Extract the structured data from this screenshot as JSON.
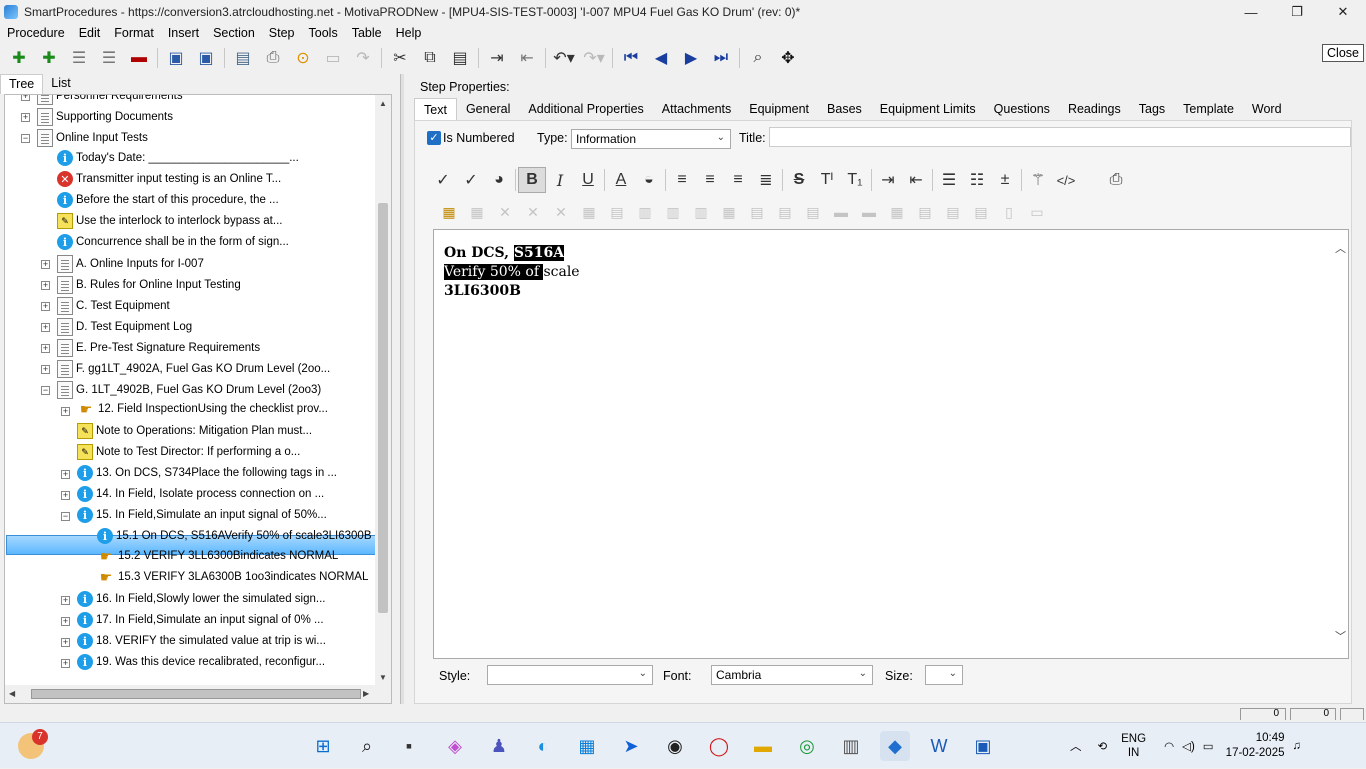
{
  "window": {
    "title": "SmartProcedures - https://conversion3.atrcloudhosting.net - MotivaPRODNew - [MPU4-SIS-TEST-0003] 'I-007 MPU4 Fuel Gas KO Drum' (rev: 0)*",
    "minimize": "—",
    "maximize": "❐",
    "close": "✕"
  },
  "menu": [
    "Procedure",
    "Edit",
    "Format",
    "Insert",
    "Section",
    "Step",
    "Tools",
    "Table",
    "Help"
  ],
  "close_tab": "Close",
  "tree_tabs": [
    "Tree",
    "List"
  ],
  "tree": [
    {
      "text": "Personnel Requirements",
      "icon": "doc",
      "level": 1,
      "expander": "+"
    },
    {
      "text": "Supporting Documents",
      "icon": "doc",
      "level": 1,
      "expander": "+"
    },
    {
      "text": "Online Input Tests",
      "icon": "doc",
      "level": 1,
      "expander": "−"
    },
    {
      "text": "Today's Date: ______________________...",
      "icon": "info",
      "level": 2,
      "expander": ""
    },
    {
      "text": "Transmitter input testing is an Online T...",
      "icon": "error",
      "level": 2,
      "expander": ""
    },
    {
      "text": "Before the start of this procedure, the ...",
      "icon": "info",
      "level": 2,
      "expander": ""
    },
    {
      "text": "Use the interlock to interlock bypass at...",
      "icon": "note",
      "level": 2,
      "expander": ""
    },
    {
      "text": "Concurrence shall be in the form of sign...",
      "icon": "info",
      "level": 2,
      "expander": ""
    },
    {
      "text": "A. Online Inputs for I-007",
      "icon": "doc",
      "level": 2,
      "expander": "+"
    },
    {
      "text": "B. Rules for Online Input Testing",
      "icon": "doc",
      "level": 2,
      "expander": "+"
    },
    {
      "text": "C. Test Equipment",
      "icon": "doc",
      "level": 2,
      "expander": "+"
    },
    {
      "text": "D. Test Equipment Log",
      "icon": "doc",
      "level": 2,
      "expander": "+"
    },
    {
      "text": "E. Pre-Test Signature Requirements",
      "icon": "doc",
      "level": 2,
      "expander": "+"
    },
    {
      "text": "F. gg1LT_4902A, Fuel Gas KO Drum Level (2oo...",
      "icon": "doc",
      "level": 2,
      "expander": "+"
    },
    {
      "text": "G. 1LT_4902B, Fuel Gas KO Drum Level (2oo3)",
      "icon": "doc",
      "level": 2,
      "expander": "−"
    },
    {
      "text": "12. Field InspectionUsing the checklist prov...",
      "icon": "hand",
      "level": 3,
      "expander": "+"
    },
    {
      "text": "Note to Operations: Mitigation Plan must...",
      "icon": "note",
      "level": 3,
      "expander": ""
    },
    {
      "text": "Note to Test Director: If performing a o...",
      "icon": "note",
      "level": 3,
      "expander": ""
    },
    {
      "text": "13. On DCS, S734Place the following tags in ...",
      "icon": "info",
      "level": 3,
      "expander": "+"
    },
    {
      "text": "14. In Field, Isolate process connection on ...",
      "icon": "info",
      "level": 3,
      "expander": "+"
    },
    {
      "text": "15. In Field,Simulate an input signal of 50%...",
      "icon": "info",
      "level": 3,
      "expander": "−"
    },
    {
      "text": "15.1 On DCS, S516AVerify 50% of scale3LI6300B",
      "icon": "info",
      "level": 4,
      "expander": "",
      "selected": true
    },
    {
      "text": "15.2 VERIFY 3LL6300Bindicates NORMAL",
      "icon": "hand",
      "level": 4,
      "expander": ""
    },
    {
      "text": "15.3 VERIFY 3LA6300B 1oo3indicates NORMAL",
      "icon": "hand",
      "level": 4,
      "expander": ""
    },
    {
      "text": "16. In Field,Slowly lower the simulated sign...",
      "icon": "info",
      "level": 3,
      "expander": "+"
    },
    {
      "text": "17. In Field,Simulate an input signal of 0% ...",
      "icon": "info",
      "level": 3,
      "expander": "+"
    },
    {
      "text": "18. VERIFY the simulated value at trip is wi...",
      "icon": "info",
      "level": 3,
      "expander": "+"
    },
    {
      "text": "19. Was this device recalibrated, reconfigur...",
      "icon": "info",
      "level": 3,
      "expander": "+"
    }
  ],
  "props": {
    "title": "Step Properties:",
    "tabs": [
      "Text",
      "General",
      "Additional Properties",
      "Attachments",
      "Equipment",
      "Bases",
      "Equipment Limits",
      "Questions",
      "Readings",
      "Tags",
      "Template",
      "Word"
    ],
    "is_numbered_label": "Is Numbered",
    "is_numbered": true,
    "type_label": "Type:",
    "type_value": "Information",
    "title_label": "Title:",
    "title_value": ""
  },
  "editor": {
    "line1_prefix": "On DCS, ",
    "line1_hl": "S516A",
    "line2_hl": "Verify 50% of ",
    "line2_rest": "scale",
    "line3": "3LI6300B"
  },
  "bottom": {
    "style_label": "Style:",
    "style_value": "",
    "font_label": "Font:",
    "font_value": "Cambria",
    "size_label": "Size:",
    "size_value": ""
  },
  "status": {
    "box1": "0",
    "box2": "0"
  },
  "taskbar": {
    "notification_count": "7",
    "lang_line1": "ENG",
    "lang_line2": "IN",
    "time": "10:49",
    "date": "17-02-2025"
  }
}
